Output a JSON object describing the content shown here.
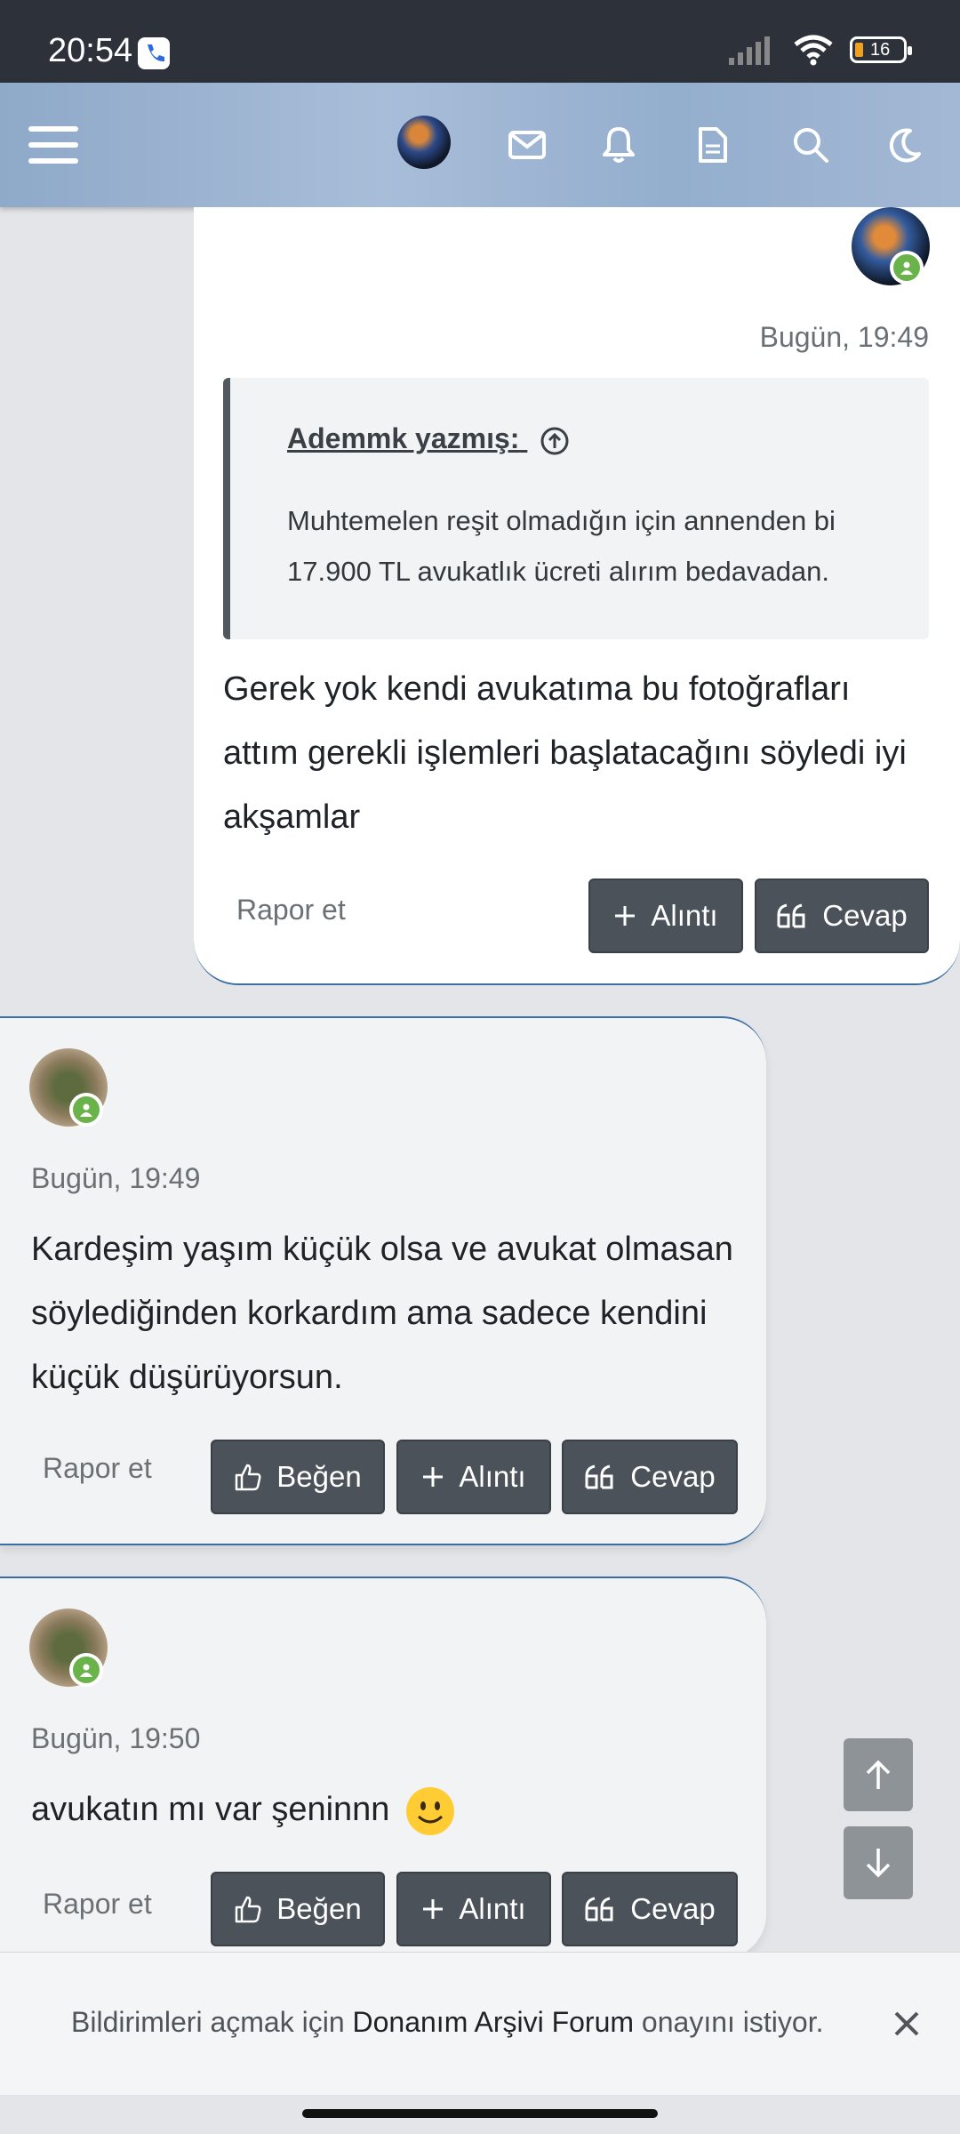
{
  "status_bar": {
    "time": "20:54",
    "battery": "16"
  },
  "nav": {
    "icons": [
      "menu-icon",
      "avatar",
      "mail-icon",
      "bell-icon",
      "document-icon",
      "search-icon",
      "moon-icon"
    ]
  },
  "posts": [
    {
      "timestamp": "Bugün, 19:49",
      "quote_author": "Ademmk yazmış:",
      "quote_text": "Muhtemelen reşit olmadığın için annenden bi 17.900 TL avukatlık ücreti alırım bedavadan.",
      "message": "Gerek yok kendi avukatıma bu fotoğrafları attım gerekli işlemleri başlatacağını söyledi iyi akşamlar",
      "report_label": "Rapor et",
      "quote_label": "Alıntı",
      "reply_label": "Cevap"
    },
    {
      "timestamp": "Bugün, 19:49",
      "message": "Kardeşim yaşım küçük olsa ve avukat olmasan söylediğinden korkardım ama sadece kendini küçük düşürüyorsun.",
      "report_label": "Rapor et",
      "like_label": "Beğen",
      "quote_label": "Alıntı",
      "reply_label": "Cevap"
    },
    {
      "timestamp": "Bugün, 19:50",
      "message": "avukatın mı var şeninnn",
      "report_label": "Rapor et",
      "like_label": "Beğen",
      "quote_label": "Alıntı",
      "reply_label": "Cevap"
    }
  ],
  "notification": {
    "text_prefix": "Bildirimleri açmak için",
    "site_name": "Donanım Arşivi Forum",
    "text_suffix": "onayını istiyor."
  },
  "colors": {
    "accent": "#3a6ea5",
    "button": "#4b5259",
    "online": "#6ab24a"
  }
}
